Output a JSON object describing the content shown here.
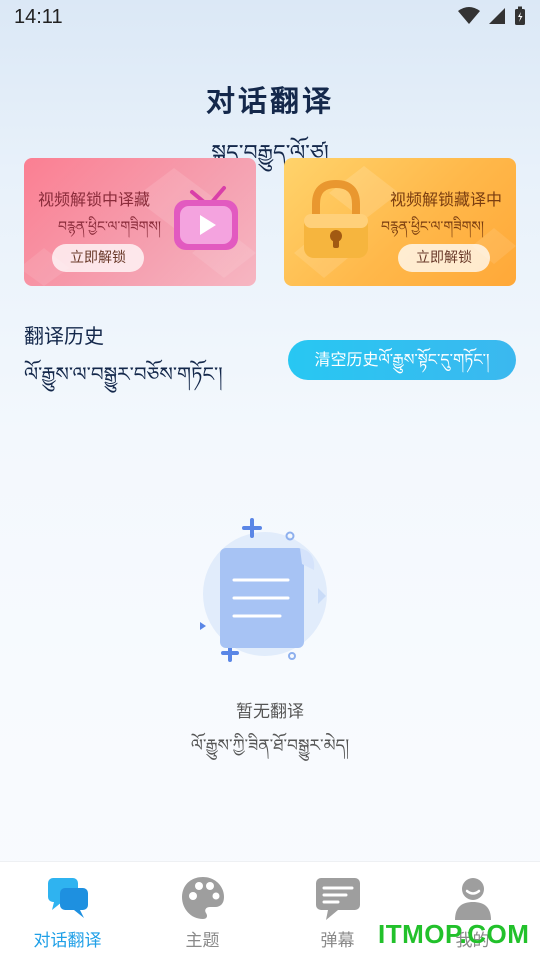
{
  "status_bar": {
    "time": "14:11"
  },
  "header": {
    "title": "对话翻译",
    "subtitle": "སྐད་བརྒྱུད་ལོ་ཙཱ།"
  },
  "cards": {
    "left": {
      "title": "视频解锁中译藏",
      "subtitle": "བརྙན་ཕྱིང་ལ་གཟིགས།",
      "button": "立即解锁"
    },
    "right": {
      "title": "视频解锁藏译中",
      "subtitle": "བརྙན་ཕྱིང་ལ་གཟིགས།",
      "button": "立即解锁"
    }
  },
  "history": {
    "title": "翻译历史",
    "subtitle": "ལོ་རྒྱུས་ལ་བསྒྱུར་བཅོས་གཏོང་།",
    "clear_button": "清空历史ལོ་རྒྱུས་སྟོང་དུ་གཏོང་།"
  },
  "empty_state": {
    "text": "暂无翻译",
    "subtext": "ལོ་རྒྱུས་ཀྱི་ཟིན་ཐོ་བསྒྱུར་མེད།"
  },
  "bottom_nav": {
    "items": [
      {
        "label": "对话翻译",
        "icon": "chat-bubbles-icon",
        "active": true
      },
      {
        "label": "主题",
        "icon": "palette-icon",
        "active": false
      },
      {
        "label": "弹幕",
        "icon": "danmaku-icon",
        "active": false
      },
      {
        "label": "我的",
        "icon": "person-icon",
        "active": false
      }
    ]
  },
  "watermark": "ITMOP.COM",
  "colors": {
    "accent": "#1e9fe7",
    "title": "#14284b",
    "clear_button": "#28c7f2",
    "card_left": "#fb7f92",
    "card_right": "#ffb84a",
    "watermark": "#22c12b"
  }
}
